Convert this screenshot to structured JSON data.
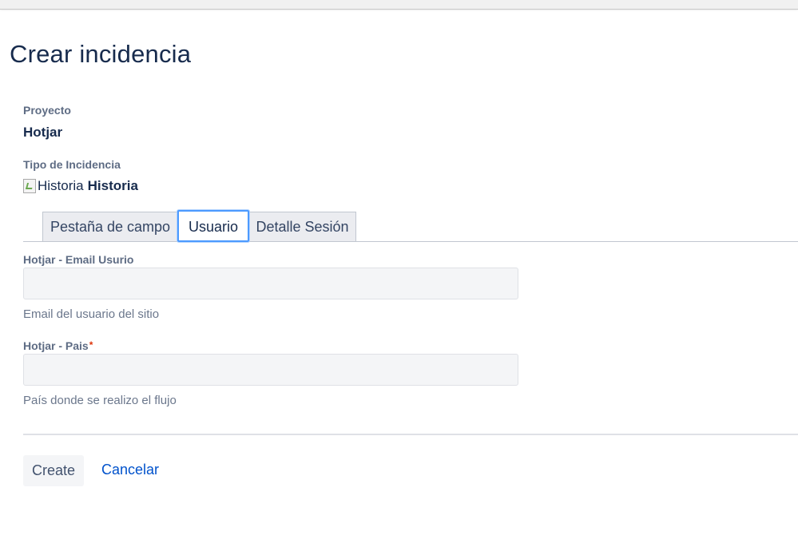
{
  "page": {
    "title": "Crear incidencia"
  },
  "project": {
    "label": "Proyecto",
    "value": "Hotjar"
  },
  "issue_type": {
    "label": "Tipo de Incidencia",
    "icon_alt": "Historia",
    "value": "Historia"
  },
  "tabs": [
    {
      "label": "Pestaña de campo",
      "selected": false
    },
    {
      "label": "Usuario",
      "selected": true
    },
    {
      "label": "Detalle Sesión",
      "selected": false
    }
  ],
  "fields": {
    "email": {
      "label": "Hotjar - Email Usurio",
      "value": "",
      "help": "Email del usuario del sitio"
    },
    "pais": {
      "label": "Hotjar - Pais",
      "required_mark": "*",
      "value": "",
      "help": "País donde se realizo el flujo"
    }
  },
  "actions": {
    "create_label": "Create",
    "cancel_label": "Cancelar"
  },
  "colors": {
    "link": "#0052cc",
    "focus_ring": "#4c9aff",
    "required": "#de350b",
    "heading": "#172b4d"
  }
}
